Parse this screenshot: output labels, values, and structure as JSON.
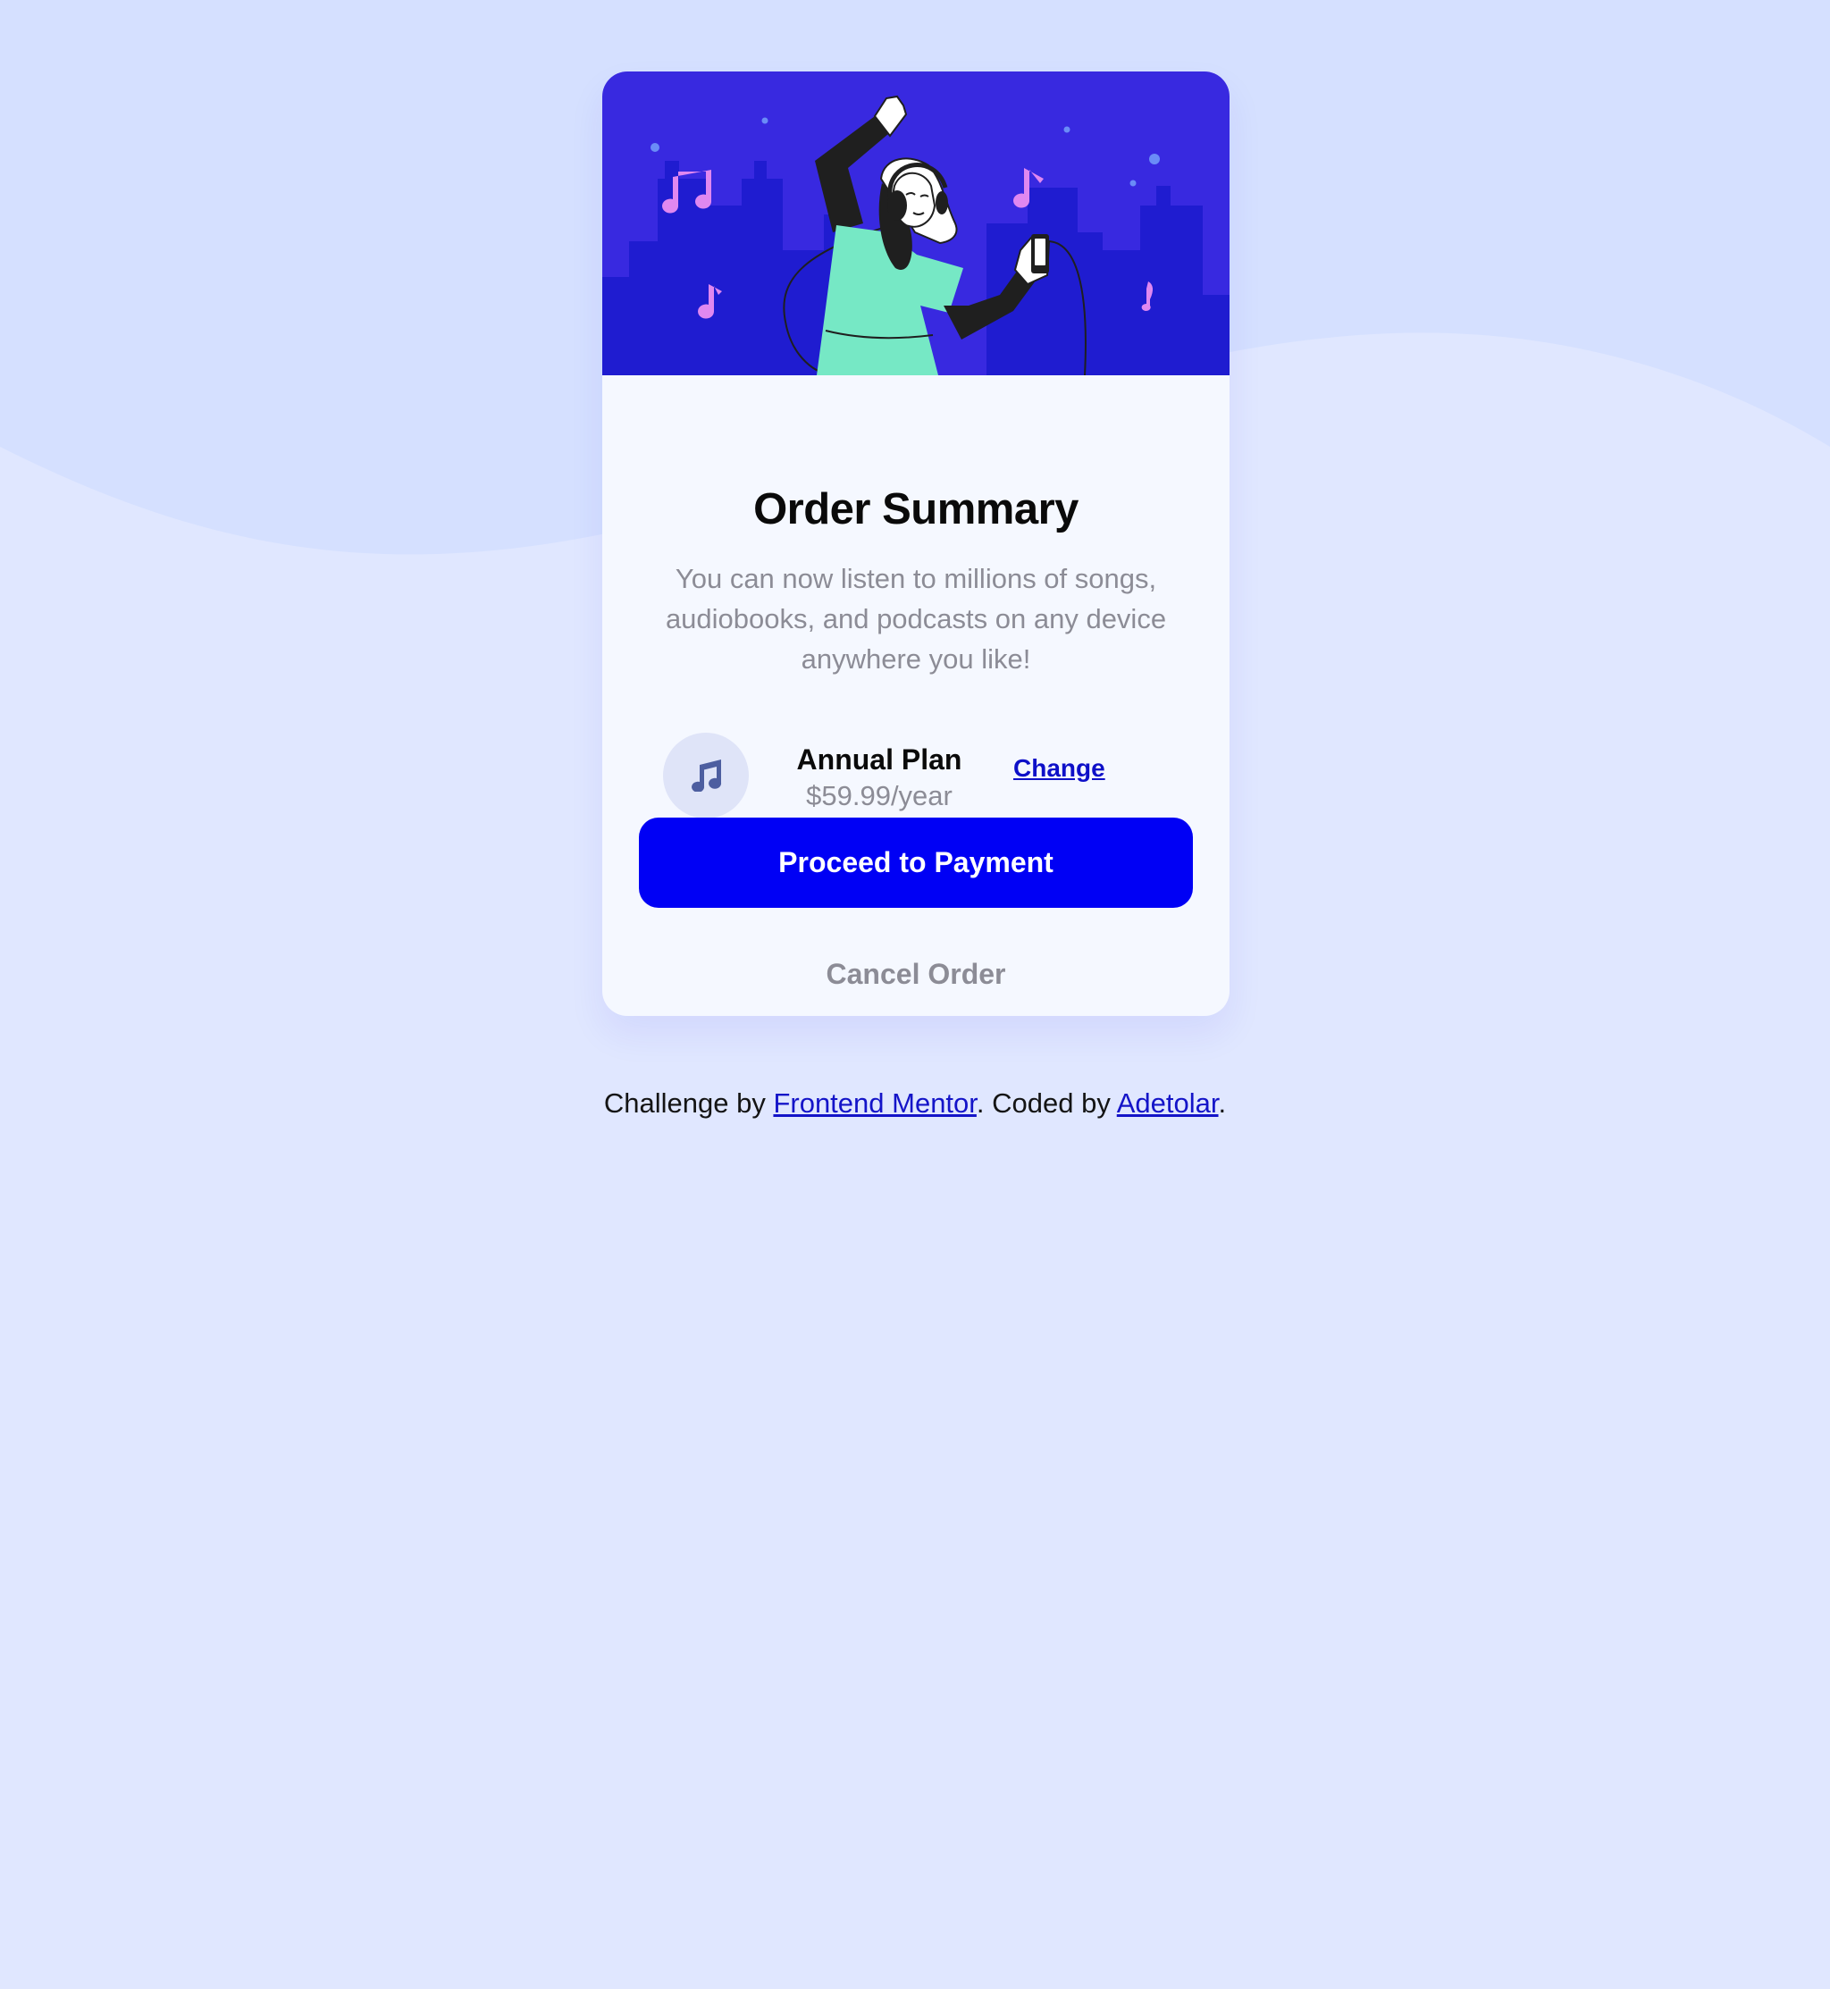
{
  "colors": {
    "page_background": "#e0e7ff",
    "wave_top": "#d5e0ff",
    "card_background": "#f5f8ff",
    "hero_background": "#3829e0",
    "primary_button": "#0000f5",
    "link": "#0e10c8",
    "muted_text": "#8c8c96"
  },
  "card": {
    "hero_illustration": "person-dancing-with-headphones-illustration",
    "title": "Order Summary",
    "description": "You can now listen to millions of songs, audiobooks, and podcasts on any device anywhere you like!",
    "plan": {
      "icon": "music-note-icon",
      "name": "Annual Plan",
      "price": "$59.99/year",
      "change_label": "Change"
    },
    "proceed_label": "Proceed to Payment",
    "cancel_label": "Cancel Order"
  },
  "footer": {
    "prefix": "Challenge by ",
    "link_1": "Frontend Mentor",
    "middle": ". Coded by ",
    "link_2": "Adetolar",
    "suffix": "."
  }
}
